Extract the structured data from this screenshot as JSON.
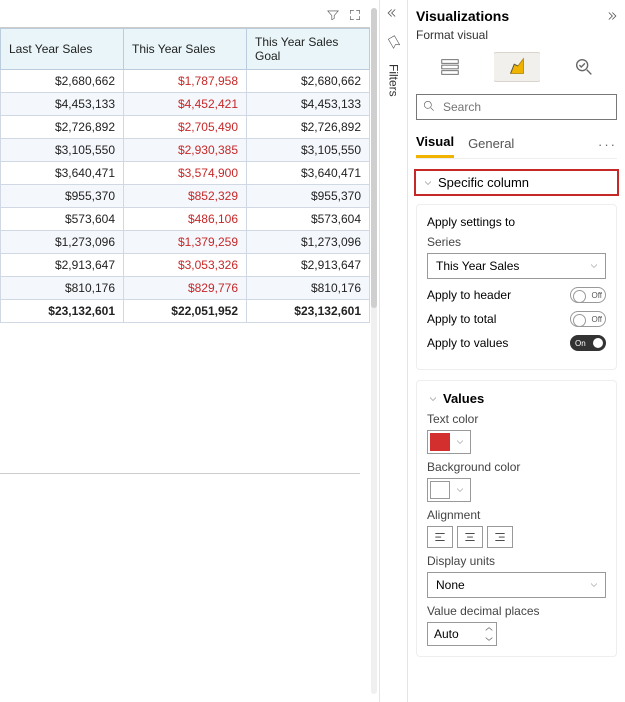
{
  "canvas": {
    "columns": [
      "Last Year Sales",
      "This Year Sales",
      "This Year Sales Goal"
    ],
    "rows": [
      [
        "$2,680,662",
        "$1,787,958",
        "$2,680,662"
      ],
      [
        "$4,453,133",
        "$4,452,421",
        "$4,453,133"
      ],
      [
        "$2,726,892",
        "$2,705,490",
        "$2,726,892"
      ],
      [
        "$3,105,550",
        "$2,930,385",
        "$3,105,550"
      ],
      [
        "$3,640,471",
        "$3,574,900",
        "$3,640,471"
      ],
      [
        "$955,370",
        "$852,329",
        "$955,370"
      ],
      [
        "$573,604",
        "$486,106",
        "$573,604"
      ],
      [
        "$1,273,096",
        "$1,379,259",
        "$1,273,096"
      ],
      [
        "$2,913,647",
        "$3,053,326",
        "$2,913,647"
      ],
      [
        "$810,176",
        "$829,776",
        "$810,176"
      ]
    ],
    "totals": [
      "$23,132,601",
      "$22,051,952",
      "$23,132,601"
    ]
  },
  "filters": {
    "label": "Filters"
  },
  "pane": {
    "title": "Visualizations",
    "subtitle": "Format visual",
    "search_placeholder": "Search",
    "tabs": {
      "visual": "Visual",
      "general": "General"
    },
    "specific_column": "Specific column",
    "apply_card": {
      "heading": "Apply settings to",
      "series_label": "Series",
      "series_value": "This Year Sales",
      "apply_header": "Apply to header",
      "apply_total": "Apply to total",
      "apply_values": "Apply to values",
      "off": "Off",
      "on": "On"
    },
    "values_card": {
      "heading": "Values",
      "text_color_label": "Text color",
      "text_color": "#d32f2f",
      "bg_color_label": "Background color",
      "bg_color": "#ffffff",
      "alignment_label": "Alignment",
      "display_units_label": "Display units",
      "display_units_value": "None",
      "decimal_label": "Value decimal places",
      "decimal_value": "Auto"
    }
  }
}
